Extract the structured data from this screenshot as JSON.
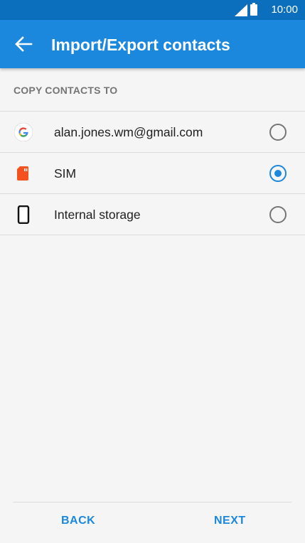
{
  "status_bar": {
    "time": "10:00",
    "icons": [
      "signal-icon",
      "battery-icon"
    ],
    "background": "#0b6fbd"
  },
  "app_bar": {
    "title": "Import/Export contacts",
    "back_icon": "arrow-left-icon",
    "background": "#1b87dd"
  },
  "section": {
    "header": "COPY CONTACTS TO"
  },
  "options": [
    {
      "label": "alan.jones.wm@gmail.com",
      "icon": "google-icon",
      "selected": false
    },
    {
      "label": "SIM",
      "icon": "sim-card-icon",
      "selected": true
    },
    {
      "label": "Internal storage",
      "icon": "phone-icon",
      "selected": false
    }
  ],
  "footer": {
    "back_label": "BACK",
    "next_label": "NEXT"
  },
  "colors": {
    "accent": "#1b87dd",
    "sim_icon": "#f4511e"
  }
}
